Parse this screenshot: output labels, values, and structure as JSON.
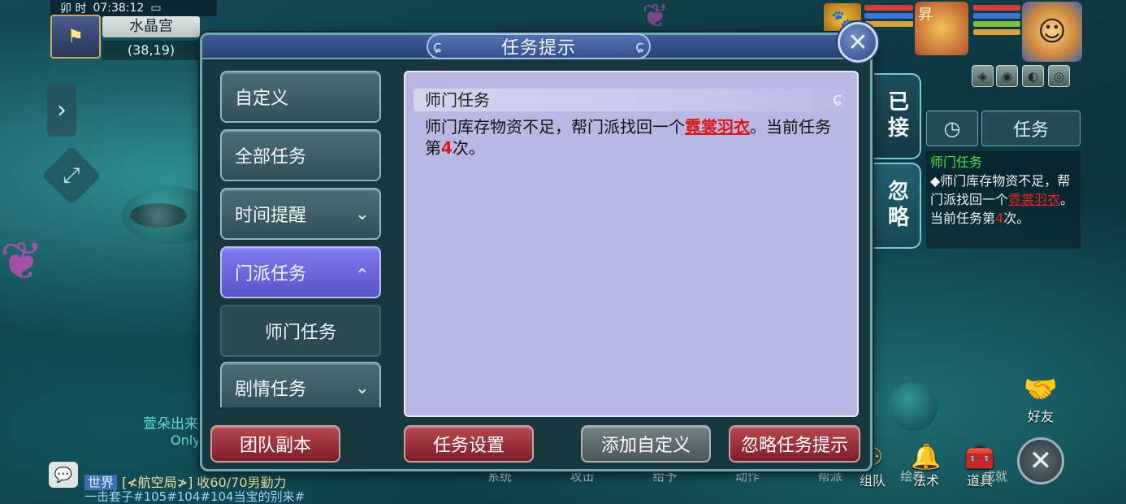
{
  "hud": {
    "period": "卯 时",
    "clock": "07:38:12",
    "location": "水晶宫",
    "coords": "(38,19)"
  },
  "dialog": {
    "title": "任务提示",
    "categories": [
      {
        "label": "自定义"
      },
      {
        "label": "全部任务"
      },
      {
        "label": "时间提醒"
      },
      {
        "label": "门派任务"
      },
      {
        "label": "剧情任务"
      }
    ],
    "subcategory": "师门任务",
    "content": {
      "title": "师门任务",
      "text_before": "师门库存物资不足，帮门派找回一个",
      "item_link": "霓裳羽衣",
      "text_middle": "。当前任务第",
      "count": "4",
      "text_after": "次。"
    },
    "footer": {
      "team_dungeon": "团队副本",
      "task_settings": "任务设置",
      "add_custom": "添加自定义",
      "ignore_hints": "忽略任务提示"
    }
  },
  "side_tabs": {
    "accepted": "已接",
    "ignored": "忽略"
  },
  "tracker": {
    "task_button": "任务",
    "title": "师门任务",
    "text_before": "◆师门库存物资不足，帮门派找回一个",
    "item_link": "霓裳羽衣",
    "text_middle": "。当前任务第",
    "count": "4",
    "text_after": "次。"
  },
  "bottom_menu": [
    "系统",
    "攻击",
    "给予",
    "动作",
    "帮派",
    "绘卷",
    "成就"
  ],
  "bottom_icons": {
    "team": "组队",
    "skills": "法术",
    "items": "道具",
    "friends": "好友"
  },
  "chat": {
    "channel": "世界",
    "line1": "[≮航空局≯] 收60/70男勤力",
    "line2": "一击套子#105#104#104当宝的别来#"
  },
  "npc": {
    "name": "萱朵出来",
    "sub": "Only"
  },
  "colors": {
    "active_category": "#6a67dc",
    "content_bg": "#b9b7e4",
    "red_button": "#9a2f38",
    "link_red": "#e01616",
    "tracker_green": "#49e34e"
  }
}
